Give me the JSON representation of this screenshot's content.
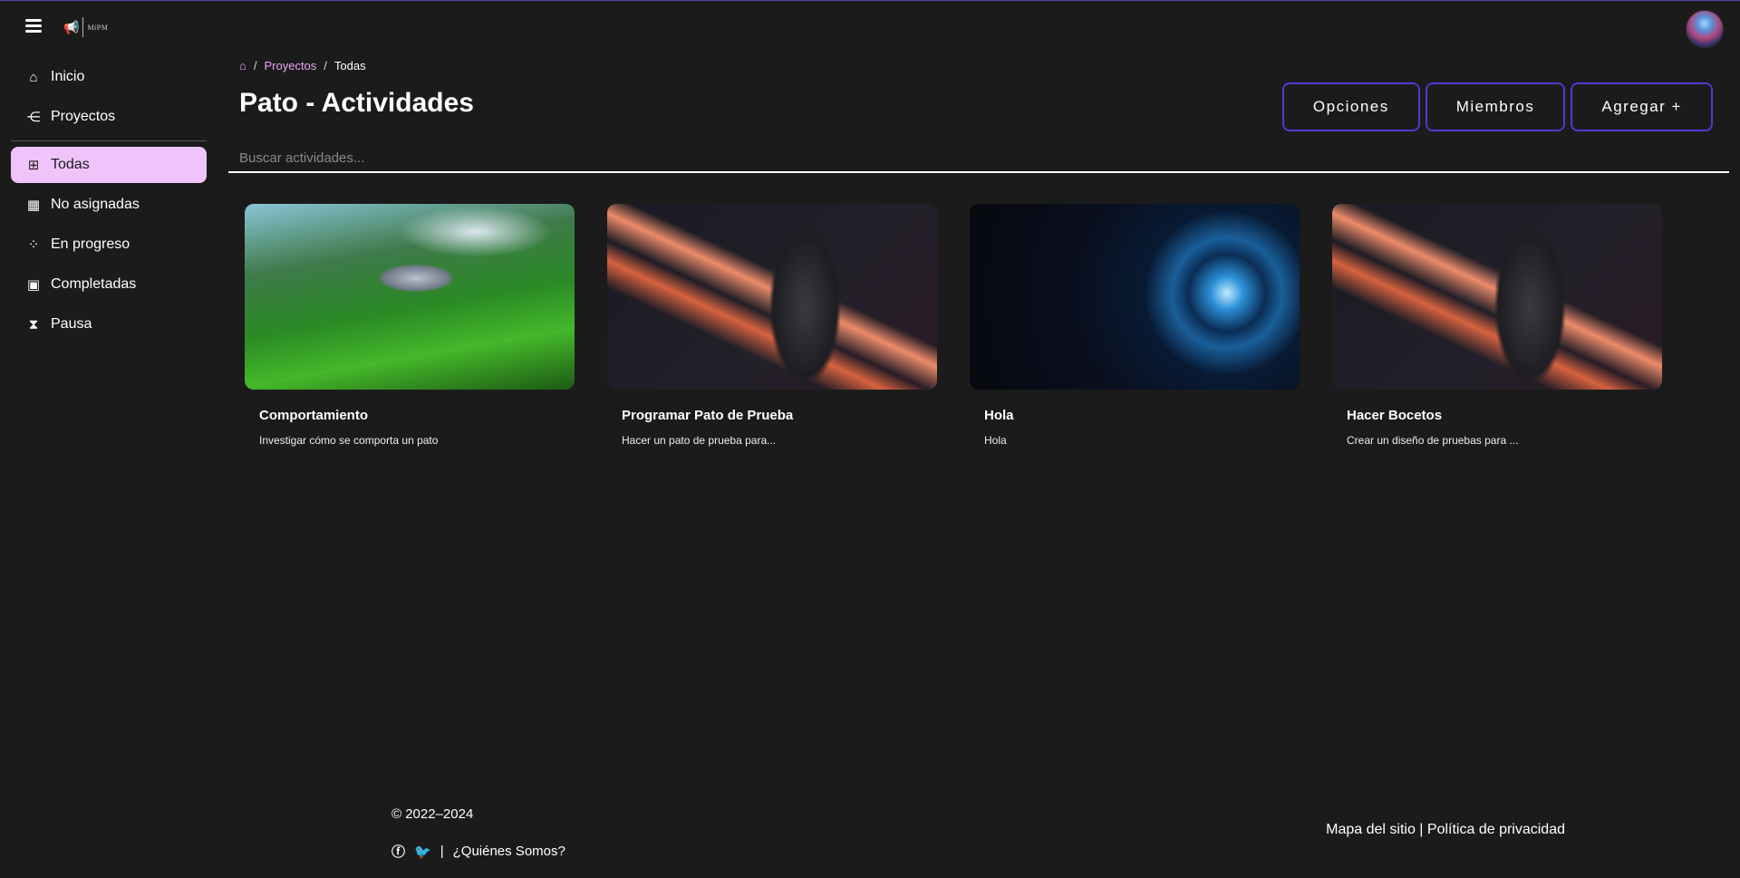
{
  "header": {
    "logo_text": "MiPM",
    "logo_icon": "megaphone-icon",
    "avatar": "user-avatar"
  },
  "sidebar": {
    "items": [
      {
        "label": "Inicio",
        "icon": "home-icon"
      },
      {
        "label": "Proyectos",
        "icon": "project-tree-icon"
      }
    ],
    "filters": [
      {
        "label": "Todas",
        "icon": "grid-icon",
        "active": true
      },
      {
        "label": "No asignadas",
        "icon": "grid-outline-icon"
      },
      {
        "label": "En progreso",
        "icon": "spinner-icon"
      },
      {
        "label": "Completadas",
        "icon": "calendar-check-icon"
      },
      {
        "label": "Pausa",
        "icon": "hourglass-icon"
      }
    ]
  },
  "breadcrumb": {
    "projects": "Proyectos",
    "current": "Todas"
  },
  "page": {
    "title": "Pato - Actividades"
  },
  "actions": {
    "options": "Opciones",
    "members": "Miembros",
    "add": "Agregar +"
  },
  "search": {
    "placeholder": "Buscar actividades..."
  },
  "cards": [
    {
      "title": "Comportamiento",
      "description": "Investigar cómo se comporta un pato"
    },
    {
      "title": "Programar Pato de Prueba",
      "description": "Hacer un pato de prueba para..."
    },
    {
      "title": "Hola",
      "description": "Hola"
    },
    {
      "title": "Hacer Bocetos",
      "description": "Crear un diseño de pruebas para ..."
    }
  ],
  "footer": {
    "copyright": "© 2022–2024",
    "about": "¿Quiénes Somos?",
    "sep": "|",
    "sitemap": "Mapa del sitio",
    "privacy": "Política de privacidad"
  },
  "colors": {
    "background": "#1b1b1b",
    "accent": "#f0c4fb",
    "button_border": "#4b3bd1",
    "link": "#e6a6f5"
  }
}
